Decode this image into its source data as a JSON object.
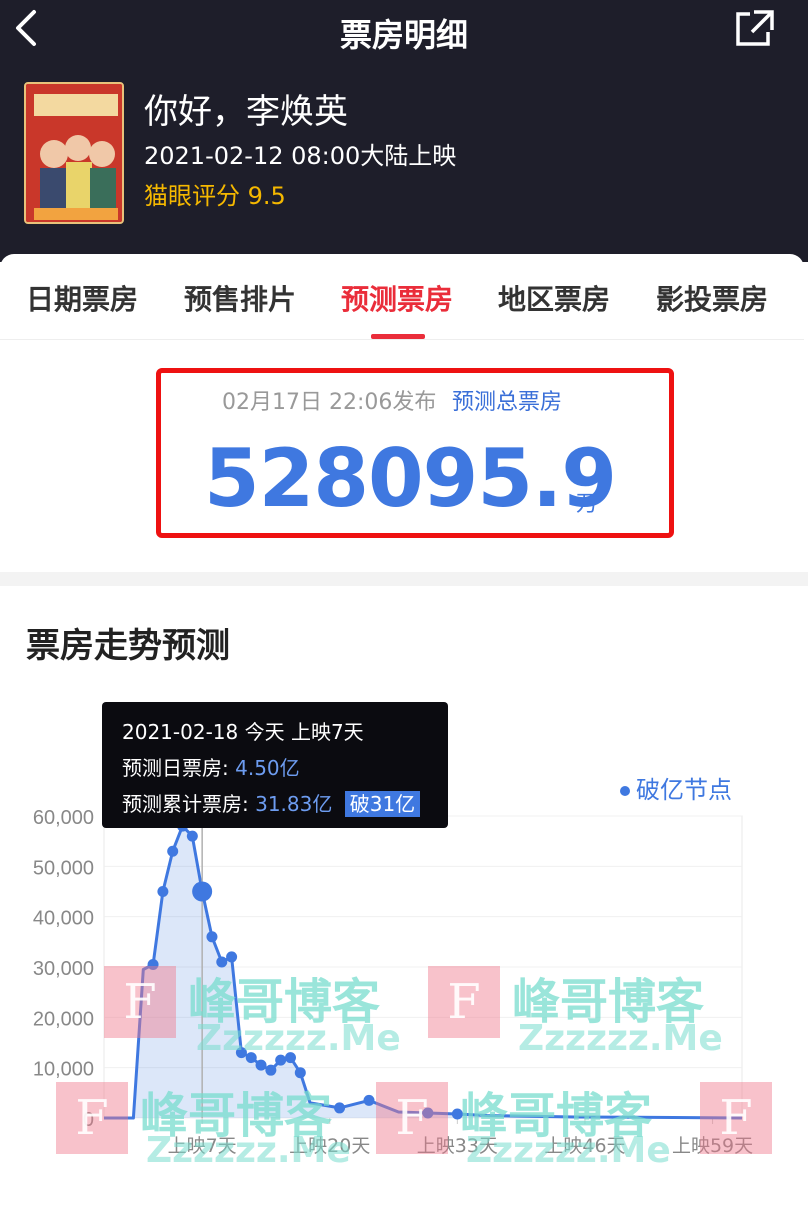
{
  "header": {
    "title": "票房明细",
    "back_icon": "chevron-left-icon",
    "share_icon": "share-icon"
  },
  "movie": {
    "title": "你好，李焕英",
    "release": "2021-02-12 08:00大陆上映",
    "rating": "猫眼评分 9.5",
    "poster_text": "你好，李焕英"
  },
  "tabs": [
    {
      "label": "日期票房",
      "active": false
    },
    {
      "label": "预售排片",
      "active": false
    },
    {
      "label": "预测票房",
      "active": true
    },
    {
      "label": "地区票房",
      "active": false
    },
    {
      "label": "影投票房",
      "active": false
    }
  ],
  "forecast": {
    "date": "02月17日 22:06发布",
    "label": "预测总票房",
    "value": "528095.9",
    "unit": "万"
  },
  "trend": {
    "title": "票房走势预测",
    "legend": "破亿节点"
  },
  "tooltip": {
    "line1": "2021-02-18 今天 上映7天",
    "line2_label": "预测日票房:",
    "line2_value": "4.50亿",
    "line3_label": "预测累计票房:",
    "line3_value": "31.83亿",
    "line3_tag": "破31亿"
  },
  "watermark": {
    "cn": "峰哥博客",
    "en": "Zzzzzz.Me",
    "letter": "F"
  },
  "colors": {
    "accent_red": "#ea2d3a",
    "blue": "#3f78e0",
    "rating_yellow": "#f5b800",
    "header_bg": "#1e1e2a"
  },
  "chart_data": {
    "type": "area",
    "ylim": [
      0,
      60000
    ],
    "yticks": [
      "60,000",
      "50,000",
      "40,000",
      "30,000",
      "20,000",
      "10,000",
      "0"
    ],
    "xticks": [
      "上映7天",
      "上映20天",
      "上映33天",
      "上映46天",
      "上映59天"
    ],
    "x": [
      -3,
      0,
      1,
      2,
      3,
      4,
      5,
      6,
      7,
      8,
      9,
      10,
      11,
      12,
      13,
      14,
      15,
      16,
      17,
      18,
      21,
      24,
      27,
      30,
      33,
      36,
      45,
      55,
      62
    ],
    "values": [
      0,
      0,
      29500,
      30500,
      45000,
      53000,
      58000,
      56000,
      45000,
      36000,
      31000,
      32000,
      13000,
      12000,
      10500,
      9500,
      11500,
      12000,
      9000,
      3000,
      2000,
      3500,
      1200,
      1000,
      800,
      500,
      200,
      100,
      0
    ],
    "highlight_x": 7,
    "milestone_x": [
      2,
      3,
      4,
      5,
      6,
      8,
      9,
      10,
      11,
      12,
      13,
      14,
      15,
      16,
      17,
      21,
      24,
      30,
      33
    ]
  }
}
